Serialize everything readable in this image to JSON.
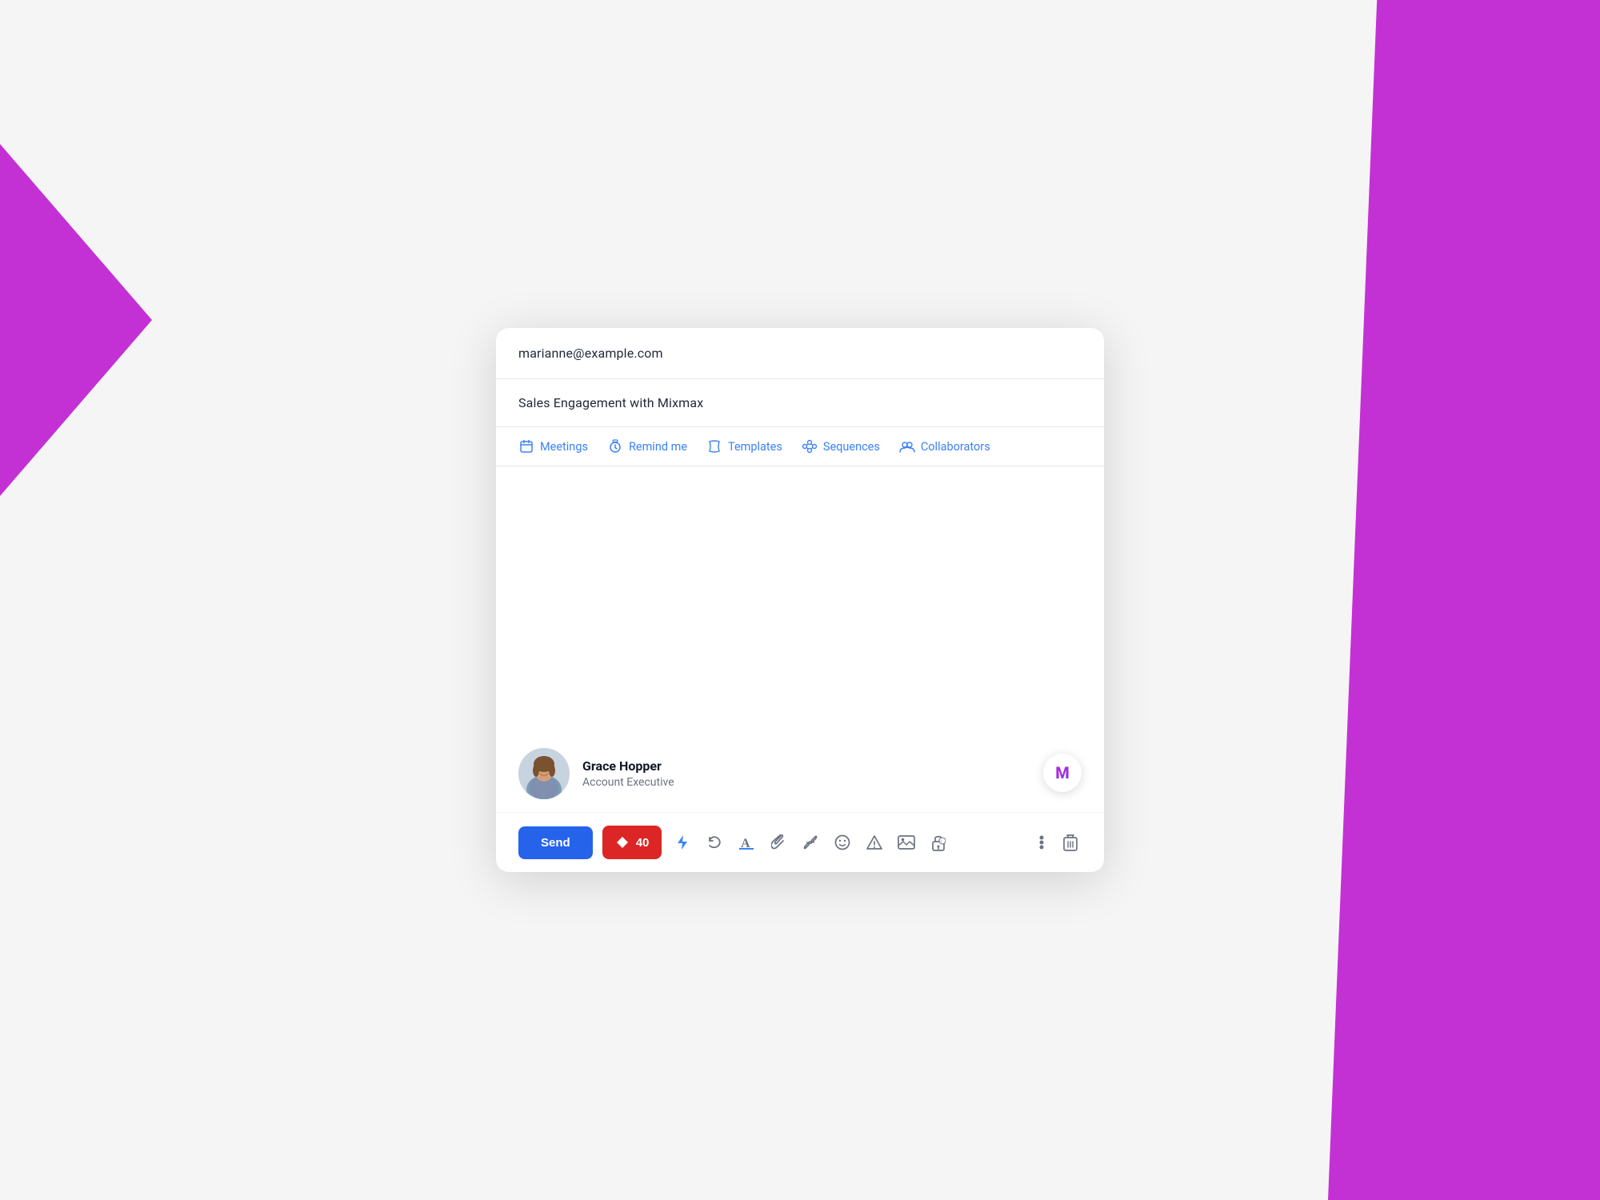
{
  "background": {
    "left_shape_color": "#c026d3",
    "right_shape_color": "#c026d3"
  },
  "compose": {
    "to_value": "marianne@example.com",
    "subject_value": "Sales Engagement with Mixmax",
    "toolbar": {
      "meetings_label": "Meetings",
      "remind_label": "Remind me",
      "templates_label": "Templates",
      "sequences_label": "Sequences",
      "collaborators_label": "Collaborators"
    },
    "person": {
      "name": "Grace Hopper",
      "title": "Account Executive"
    },
    "actions": {
      "send_label": "Send",
      "schedule_count": "40"
    }
  }
}
